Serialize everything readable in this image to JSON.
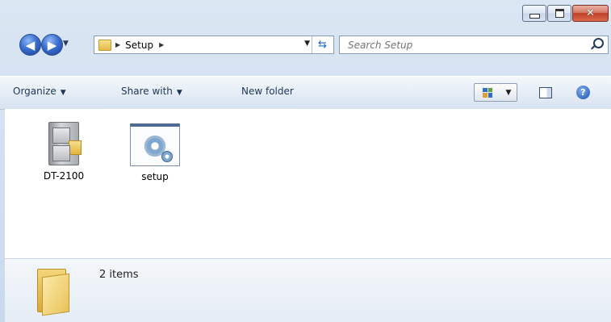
{
  "window": {
    "caption": {
      "minimize": "–",
      "maximize": "□",
      "close": "x"
    }
  },
  "nav": {
    "back_icon": "arrow-left-icon",
    "forward_icon": "arrow-right-icon",
    "breadcrumb": [
      "Setup"
    ],
    "search_placeholder": "Search Setup"
  },
  "commandbar": {
    "organize": "Organize",
    "share_with": "Share with",
    "new_folder": "New folder"
  },
  "files": [
    {
      "name": "DT-2100",
      "icon": "file-cabinet-icon"
    },
    {
      "name": "setup",
      "icon": "setup-gears-icon"
    }
  ],
  "details": {
    "item_count": "2 items"
  },
  "colors": {
    "accent": "#1f62c7",
    "close_button": "#c0402a"
  }
}
